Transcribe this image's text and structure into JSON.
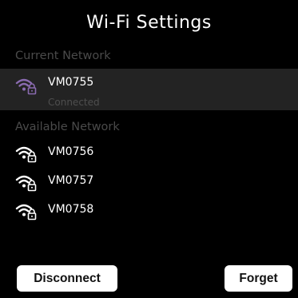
{
  "title": "Wi-Fi Settings",
  "current_section": {
    "label": "Current Network",
    "network": {
      "name": "VM0755",
      "status": "Connected",
      "icon": "wifi-lock-icon",
      "icon_color": "#8a6bb0"
    }
  },
  "available_section": {
    "label": "Available Network",
    "networks": [
      {
        "name": "VM0756",
        "icon": "wifi-lock-icon"
      },
      {
        "name": "VM0757",
        "icon": "wifi-lock-icon"
      },
      {
        "name": "VM0758",
        "icon": "wifi-lock-icon"
      }
    ]
  },
  "buttons": {
    "disconnect": "Disconnect",
    "forget": "Forget"
  },
  "colors": {
    "background": "#000000",
    "selected_row": "#232323",
    "muted_text": "#4a4a4a",
    "connected_icon": "#8a6bb0",
    "button_bg": "#ffffff"
  }
}
